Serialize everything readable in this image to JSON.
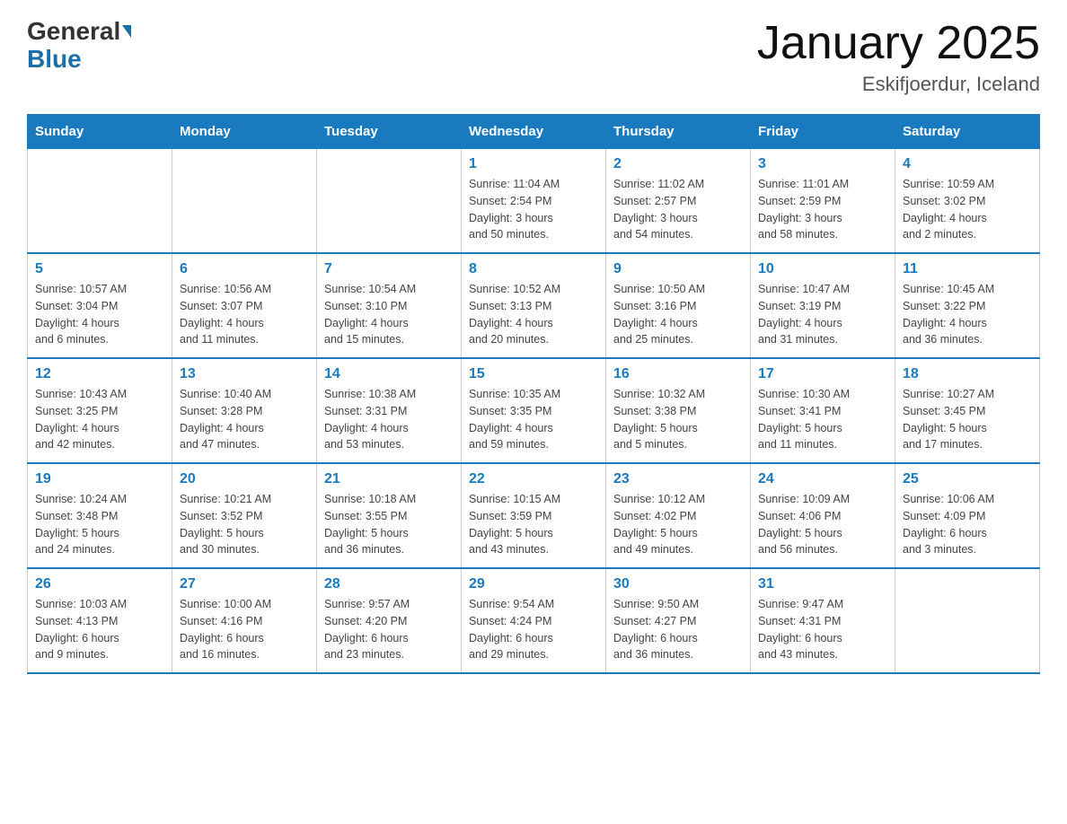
{
  "header": {
    "logo_general": "General",
    "logo_blue": "Blue",
    "month_title": "January 2025",
    "location": "Eskifjoerdur, Iceland"
  },
  "days_of_week": [
    "Sunday",
    "Monday",
    "Tuesday",
    "Wednesday",
    "Thursday",
    "Friday",
    "Saturday"
  ],
  "weeks": [
    [
      {
        "day": "",
        "info": ""
      },
      {
        "day": "",
        "info": ""
      },
      {
        "day": "",
        "info": ""
      },
      {
        "day": "1",
        "info": "Sunrise: 11:04 AM\nSunset: 2:54 PM\nDaylight: 3 hours\nand 50 minutes."
      },
      {
        "day": "2",
        "info": "Sunrise: 11:02 AM\nSunset: 2:57 PM\nDaylight: 3 hours\nand 54 minutes."
      },
      {
        "day": "3",
        "info": "Sunrise: 11:01 AM\nSunset: 2:59 PM\nDaylight: 3 hours\nand 58 minutes."
      },
      {
        "day": "4",
        "info": "Sunrise: 10:59 AM\nSunset: 3:02 PM\nDaylight: 4 hours\nand 2 minutes."
      }
    ],
    [
      {
        "day": "5",
        "info": "Sunrise: 10:57 AM\nSunset: 3:04 PM\nDaylight: 4 hours\nand 6 minutes."
      },
      {
        "day": "6",
        "info": "Sunrise: 10:56 AM\nSunset: 3:07 PM\nDaylight: 4 hours\nand 11 minutes."
      },
      {
        "day": "7",
        "info": "Sunrise: 10:54 AM\nSunset: 3:10 PM\nDaylight: 4 hours\nand 15 minutes."
      },
      {
        "day": "8",
        "info": "Sunrise: 10:52 AM\nSunset: 3:13 PM\nDaylight: 4 hours\nand 20 minutes."
      },
      {
        "day": "9",
        "info": "Sunrise: 10:50 AM\nSunset: 3:16 PM\nDaylight: 4 hours\nand 25 minutes."
      },
      {
        "day": "10",
        "info": "Sunrise: 10:47 AM\nSunset: 3:19 PM\nDaylight: 4 hours\nand 31 minutes."
      },
      {
        "day": "11",
        "info": "Sunrise: 10:45 AM\nSunset: 3:22 PM\nDaylight: 4 hours\nand 36 minutes."
      }
    ],
    [
      {
        "day": "12",
        "info": "Sunrise: 10:43 AM\nSunset: 3:25 PM\nDaylight: 4 hours\nand 42 minutes."
      },
      {
        "day": "13",
        "info": "Sunrise: 10:40 AM\nSunset: 3:28 PM\nDaylight: 4 hours\nand 47 minutes."
      },
      {
        "day": "14",
        "info": "Sunrise: 10:38 AM\nSunset: 3:31 PM\nDaylight: 4 hours\nand 53 minutes."
      },
      {
        "day": "15",
        "info": "Sunrise: 10:35 AM\nSunset: 3:35 PM\nDaylight: 4 hours\nand 59 minutes."
      },
      {
        "day": "16",
        "info": "Sunrise: 10:32 AM\nSunset: 3:38 PM\nDaylight: 5 hours\nand 5 minutes."
      },
      {
        "day": "17",
        "info": "Sunrise: 10:30 AM\nSunset: 3:41 PM\nDaylight: 5 hours\nand 11 minutes."
      },
      {
        "day": "18",
        "info": "Sunrise: 10:27 AM\nSunset: 3:45 PM\nDaylight: 5 hours\nand 17 minutes."
      }
    ],
    [
      {
        "day": "19",
        "info": "Sunrise: 10:24 AM\nSunset: 3:48 PM\nDaylight: 5 hours\nand 24 minutes."
      },
      {
        "day": "20",
        "info": "Sunrise: 10:21 AM\nSunset: 3:52 PM\nDaylight: 5 hours\nand 30 minutes."
      },
      {
        "day": "21",
        "info": "Sunrise: 10:18 AM\nSunset: 3:55 PM\nDaylight: 5 hours\nand 36 minutes."
      },
      {
        "day": "22",
        "info": "Sunrise: 10:15 AM\nSunset: 3:59 PM\nDaylight: 5 hours\nand 43 minutes."
      },
      {
        "day": "23",
        "info": "Sunrise: 10:12 AM\nSunset: 4:02 PM\nDaylight: 5 hours\nand 49 minutes."
      },
      {
        "day": "24",
        "info": "Sunrise: 10:09 AM\nSunset: 4:06 PM\nDaylight: 5 hours\nand 56 minutes."
      },
      {
        "day": "25",
        "info": "Sunrise: 10:06 AM\nSunset: 4:09 PM\nDaylight: 6 hours\nand 3 minutes."
      }
    ],
    [
      {
        "day": "26",
        "info": "Sunrise: 10:03 AM\nSunset: 4:13 PM\nDaylight: 6 hours\nand 9 minutes."
      },
      {
        "day": "27",
        "info": "Sunrise: 10:00 AM\nSunset: 4:16 PM\nDaylight: 6 hours\nand 16 minutes."
      },
      {
        "day": "28",
        "info": "Sunrise: 9:57 AM\nSunset: 4:20 PM\nDaylight: 6 hours\nand 23 minutes."
      },
      {
        "day": "29",
        "info": "Sunrise: 9:54 AM\nSunset: 4:24 PM\nDaylight: 6 hours\nand 29 minutes."
      },
      {
        "day": "30",
        "info": "Sunrise: 9:50 AM\nSunset: 4:27 PM\nDaylight: 6 hours\nand 36 minutes."
      },
      {
        "day": "31",
        "info": "Sunrise: 9:47 AM\nSunset: 4:31 PM\nDaylight: 6 hours\nand 43 minutes."
      },
      {
        "day": "",
        "info": ""
      }
    ]
  ]
}
